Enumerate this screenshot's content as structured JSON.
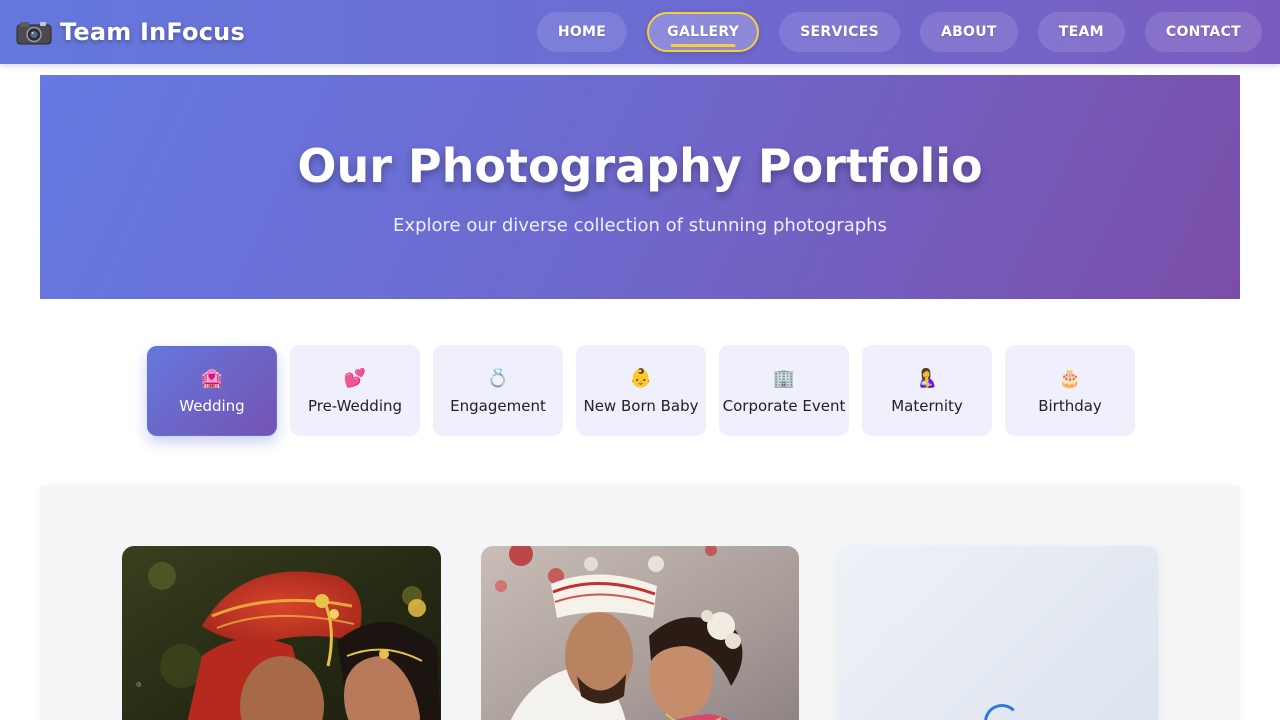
{
  "brand": {
    "title": "Team InFocus",
    "icon": "camera-icon"
  },
  "nav": {
    "items": [
      {
        "label": "HOME"
      },
      {
        "label": "GALLERY",
        "active": true
      },
      {
        "label": "SERVICES"
      },
      {
        "label": "ABOUT"
      },
      {
        "label": "TEAM"
      },
      {
        "label": "CONTACT"
      }
    ]
  },
  "hero": {
    "title": "Our Photography Portfolio",
    "subtitle": "Explore our diverse collection of stunning photographs"
  },
  "categories": [
    {
      "label": "Wedding",
      "icon": "🏩",
      "active": true
    },
    {
      "label": "Pre-Wedding",
      "icon": "💕"
    },
    {
      "label": "Engagement",
      "icon": "💍"
    },
    {
      "label": "New Born Baby",
      "icon": "👶"
    },
    {
      "label": "Corporate Event",
      "icon": "🏢"
    },
    {
      "label": "Maternity",
      "icon": "🤱"
    },
    {
      "label": "Birthday",
      "icon": "🎂"
    }
  ],
  "gallery": {
    "photos": [
      {
        "name": "wedding-photo-1",
        "status": "loaded"
      },
      {
        "name": "wedding-photo-2",
        "status": "loaded"
      },
      {
        "name": "wedding-photo-3",
        "status": "loading"
      }
    ]
  },
  "colors": {
    "accent": "#f5cf3a",
    "brand_start": "#6478dc",
    "brand_end": "#7a4ea8",
    "spinner": "#2b7bd8"
  }
}
